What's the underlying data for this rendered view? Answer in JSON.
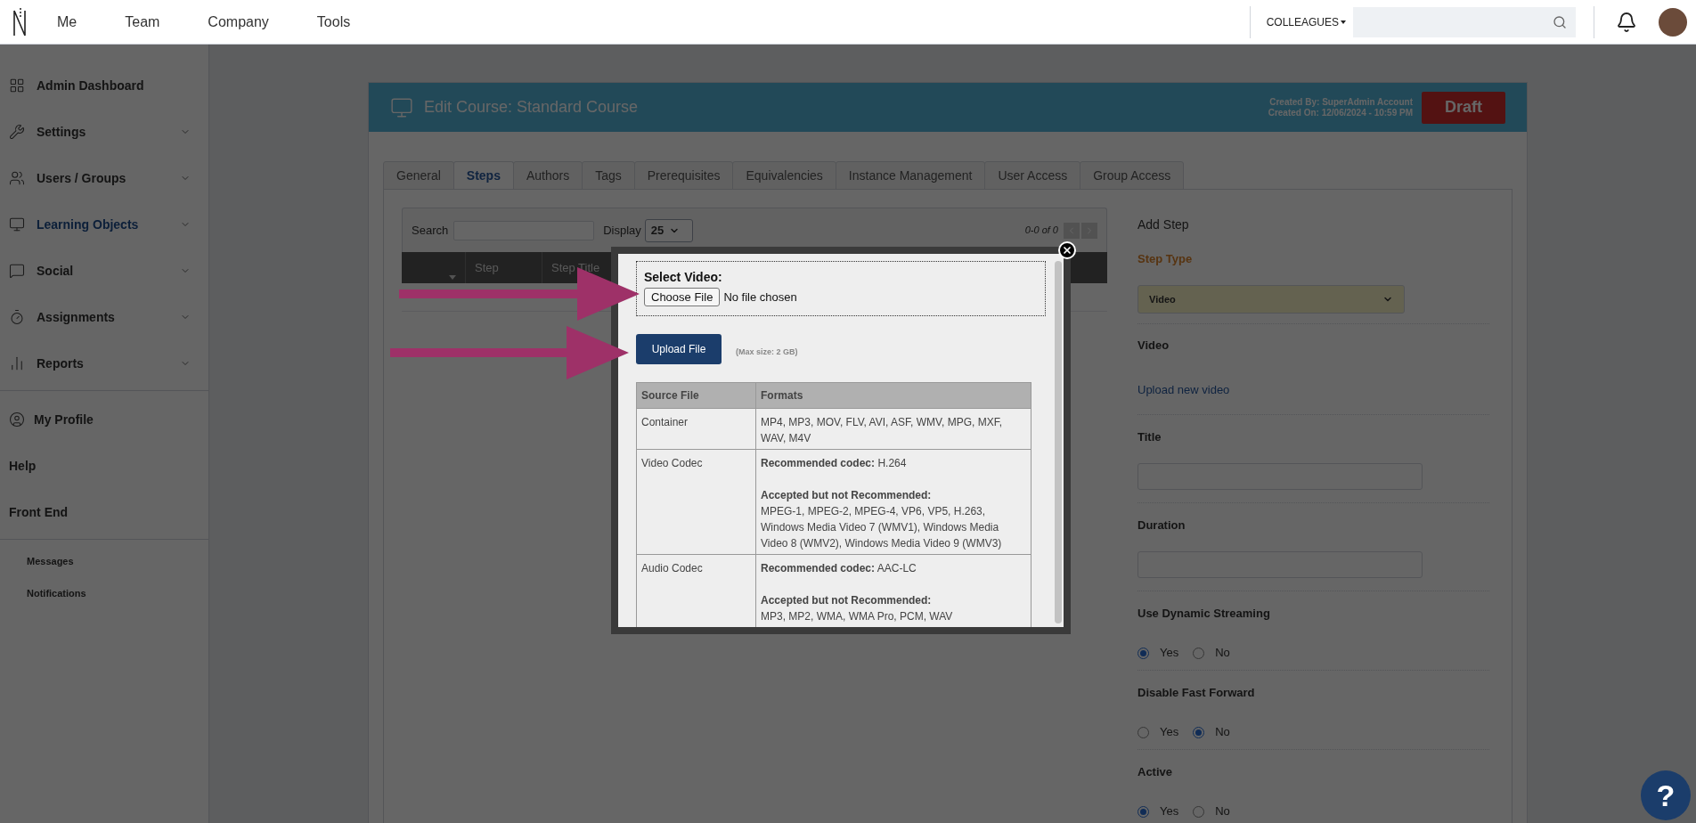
{
  "top_nav": {
    "items": [
      "Me",
      "Team",
      "Company",
      "Tools"
    ],
    "colleagues_menu": "COLLEAGUES"
  },
  "sidebar": {
    "items": [
      {
        "label": "Admin Dashboard",
        "expandable": false,
        "selected": false
      },
      {
        "label": "Settings",
        "expandable": true,
        "selected": false
      },
      {
        "label": "Users / Groups",
        "expandable": true,
        "selected": false
      },
      {
        "label": "Learning Objects",
        "expandable": true,
        "selected": true
      },
      {
        "label": "Social",
        "expandable": true,
        "selected": false
      },
      {
        "label": "Assignments",
        "expandable": true,
        "selected": false
      },
      {
        "label": "Reports",
        "expandable": true,
        "selected": false
      }
    ],
    "profile_items": [
      {
        "label": "My Profile"
      },
      {
        "label": "Help"
      },
      {
        "label": "Front End"
      }
    ],
    "sub_items": [
      "Messages",
      "Notifications"
    ]
  },
  "course": {
    "title": "Edit Course: Standard Course",
    "created_by": "Created By: SuperAdmin Account",
    "created_on": "Created On: 12/06/2024 - 10:59 PM",
    "status": "Draft",
    "tabs": [
      {
        "label": "General",
        "selected": false
      },
      {
        "label": "Steps",
        "selected": true
      },
      {
        "label": "Authors",
        "selected": false
      },
      {
        "label": "Tags",
        "selected": false
      },
      {
        "label": "Prerequisites",
        "selected": false
      },
      {
        "label": "Equivalencies",
        "selected": false
      },
      {
        "label": "Instance Management",
        "selected": false
      },
      {
        "label": "User Access",
        "selected": false
      },
      {
        "label": "Group Access",
        "selected": false
      }
    ]
  },
  "steps_table": {
    "search_label": "Search",
    "display_label": "Display",
    "display_value": "25",
    "pager": "0-0 of 0",
    "columns": [
      "Step",
      "Step Title"
    ]
  },
  "add_step": {
    "title": "Add Step",
    "step_type_label": "Step Type",
    "step_type_value": "Video",
    "video_label": "Video",
    "upload_link": "Upload new video",
    "fields": [
      {
        "label": "Title"
      },
      {
        "label": "Duration"
      }
    ],
    "radio_groups": [
      {
        "label": "Use Dynamic Streaming",
        "options": [
          {
            "label": "Yes",
            "selected": true
          },
          {
            "label": "No",
            "selected": false
          }
        ]
      },
      {
        "label": "Disable Fast Forward",
        "options": [
          {
            "label": "Yes",
            "selected": false
          },
          {
            "label": "No",
            "selected": true
          }
        ]
      },
      {
        "label": "Active",
        "options": [
          {
            "label": "Yes",
            "selected": true
          },
          {
            "label": "No",
            "selected": false
          }
        ]
      }
    ]
  },
  "upload_modal": {
    "select_label": "Select Video:",
    "choose_button": "Choose File",
    "file_status": "No file chosen",
    "upload_button": "Upload File",
    "max_size": "(Max size: 2 GB)",
    "columns": [
      "Source File",
      "Formats"
    ],
    "rows": [
      {
        "source": "Container",
        "paragraphs": [
          {
            "text": "MP4, MP3, MOV, FLV, AVI, ASF, WMV, MPG, MXF, WAV, M4V"
          }
        ]
      },
      {
        "source": "Video Codec",
        "paragraphs": [
          {
            "text": "**Recommended codec:** H.264"
          },
          {
            "heading": "Accepted but not Recommended:",
            "text": "MPEG-1, MPEG-2, MPEG-4, VP6, VP5, H.263, Windows Media Video 7 (WMV1), Windows Media Video 8 (WMV2), Windows Media Video 9 (WMV3)"
          }
        ]
      },
      {
        "source": "Audio Codec",
        "paragraphs": [
          {
            "text": "**Recommended codec:** AAC-LC"
          },
          {
            "heading": "Accepted but not Recommended:",
            "text": "MP3, MP2, WMA, WMA Pro, PCM, WAV"
          }
        ]
      }
    ]
  },
  "help_button": "?"
}
